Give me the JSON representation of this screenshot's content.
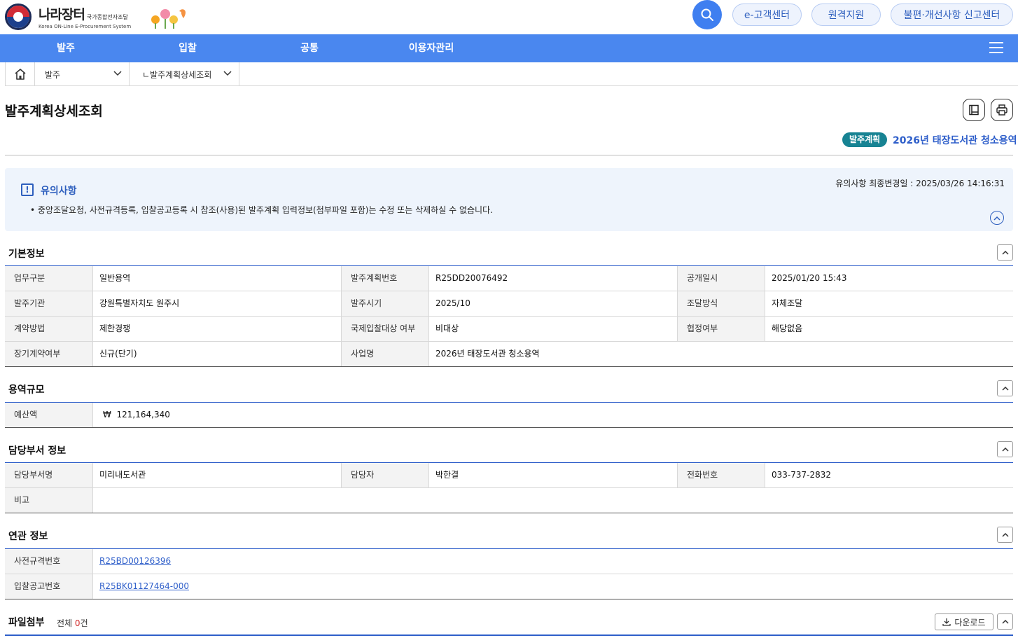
{
  "header": {
    "logo_name": "나라장터",
    "logo_sub": "국가종합전자조달",
    "logo_en": "Korea ON-Line E-Procurement System",
    "buttons": [
      "e-고객센터",
      "원격지원",
      "불편·개선사항 신고센터"
    ],
    "search_icon": "search-icon"
  },
  "nav": {
    "items": [
      "발주",
      "입찰",
      "공통",
      "이용자관리"
    ],
    "menu_icon": "hamburger-icon"
  },
  "breadcrumb": {
    "home_icon": "home-icon",
    "level1": "발주",
    "level2": "ㄴ발주계획상세조회"
  },
  "page": {
    "title": "발주계획상세조회",
    "badge": "발주계획",
    "plan_name": "2026년 태장도서관 청소용역"
  },
  "notice": {
    "title": "유의사항",
    "date_label": "유의사항 최종변경일 : 2025/03/26 14:16:31",
    "text": "• 중앙조달요청, 사전규격등록, 입찰공고등록 시 참조(사용)된 발주계획 입력정보(첨부파일 포함)는 수정 또는 삭제하실 수 없습니다."
  },
  "basic": {
    "title": "기본정보",
    "rows": [
      [
        [
          "업무구분",
          "일반용역"
        ],
        [
          "발주계획번호",
          "R25DD20076492"
        ],
        [
          "공개일시",
          "2025/01/20 15:43"
        ]
      ],
      [
        [
          "발주기관",
          "강원특별자치도 원주시"
        ],
        [
          "발주시기",
          "2025/10"
        ],
        [
          "조달방식",
          "자체조달"
        ]
      ],
      [
        [
          "계약방법",
          "제한경쟁"
        ],
        [
          "국제입찰대상 여부",
          "비대상"
        ],
        [
          "협정여부",
          "해당없음"
        ]
      ],
      [
        [
          "장기계약여부",
          "신규(단기)"
        ],
        [
          "사업명",
          "2026년 태장도서관 청소용역"
        ]
      ]
    ]
  },
  "scale": {
    "title": "용역규모",
    "budget_label": "예산액",
    "currency": "₩",
    "budget": "121,164,340"
  },
  "dept": {
    "title": "담당부서 정보",
    "dept_label": "담당부서명",
    "dept_value": "미리내도서관",
    "person_label": "담당자",
    "person_value": "박한결",
    "phone_label": "전화번호",
    "phone_value": "033-737-2832",
    "note_label": "비고",
    "note_value": ""
  },
  "related": {
    "title": "연관 정보",
    "pre_label": "사전규격번호",
    "pre_value": "R25BD00126396",
    "bid_label": "입찰공고번호",
    "bid_value": "R25BK01127464-000"
  },
  "files": {
    "title": "파일첨부",
    "total_label": "전체",
    "count": "0",
    "unit": "건",
    "download": "다운로드"
  }
}
